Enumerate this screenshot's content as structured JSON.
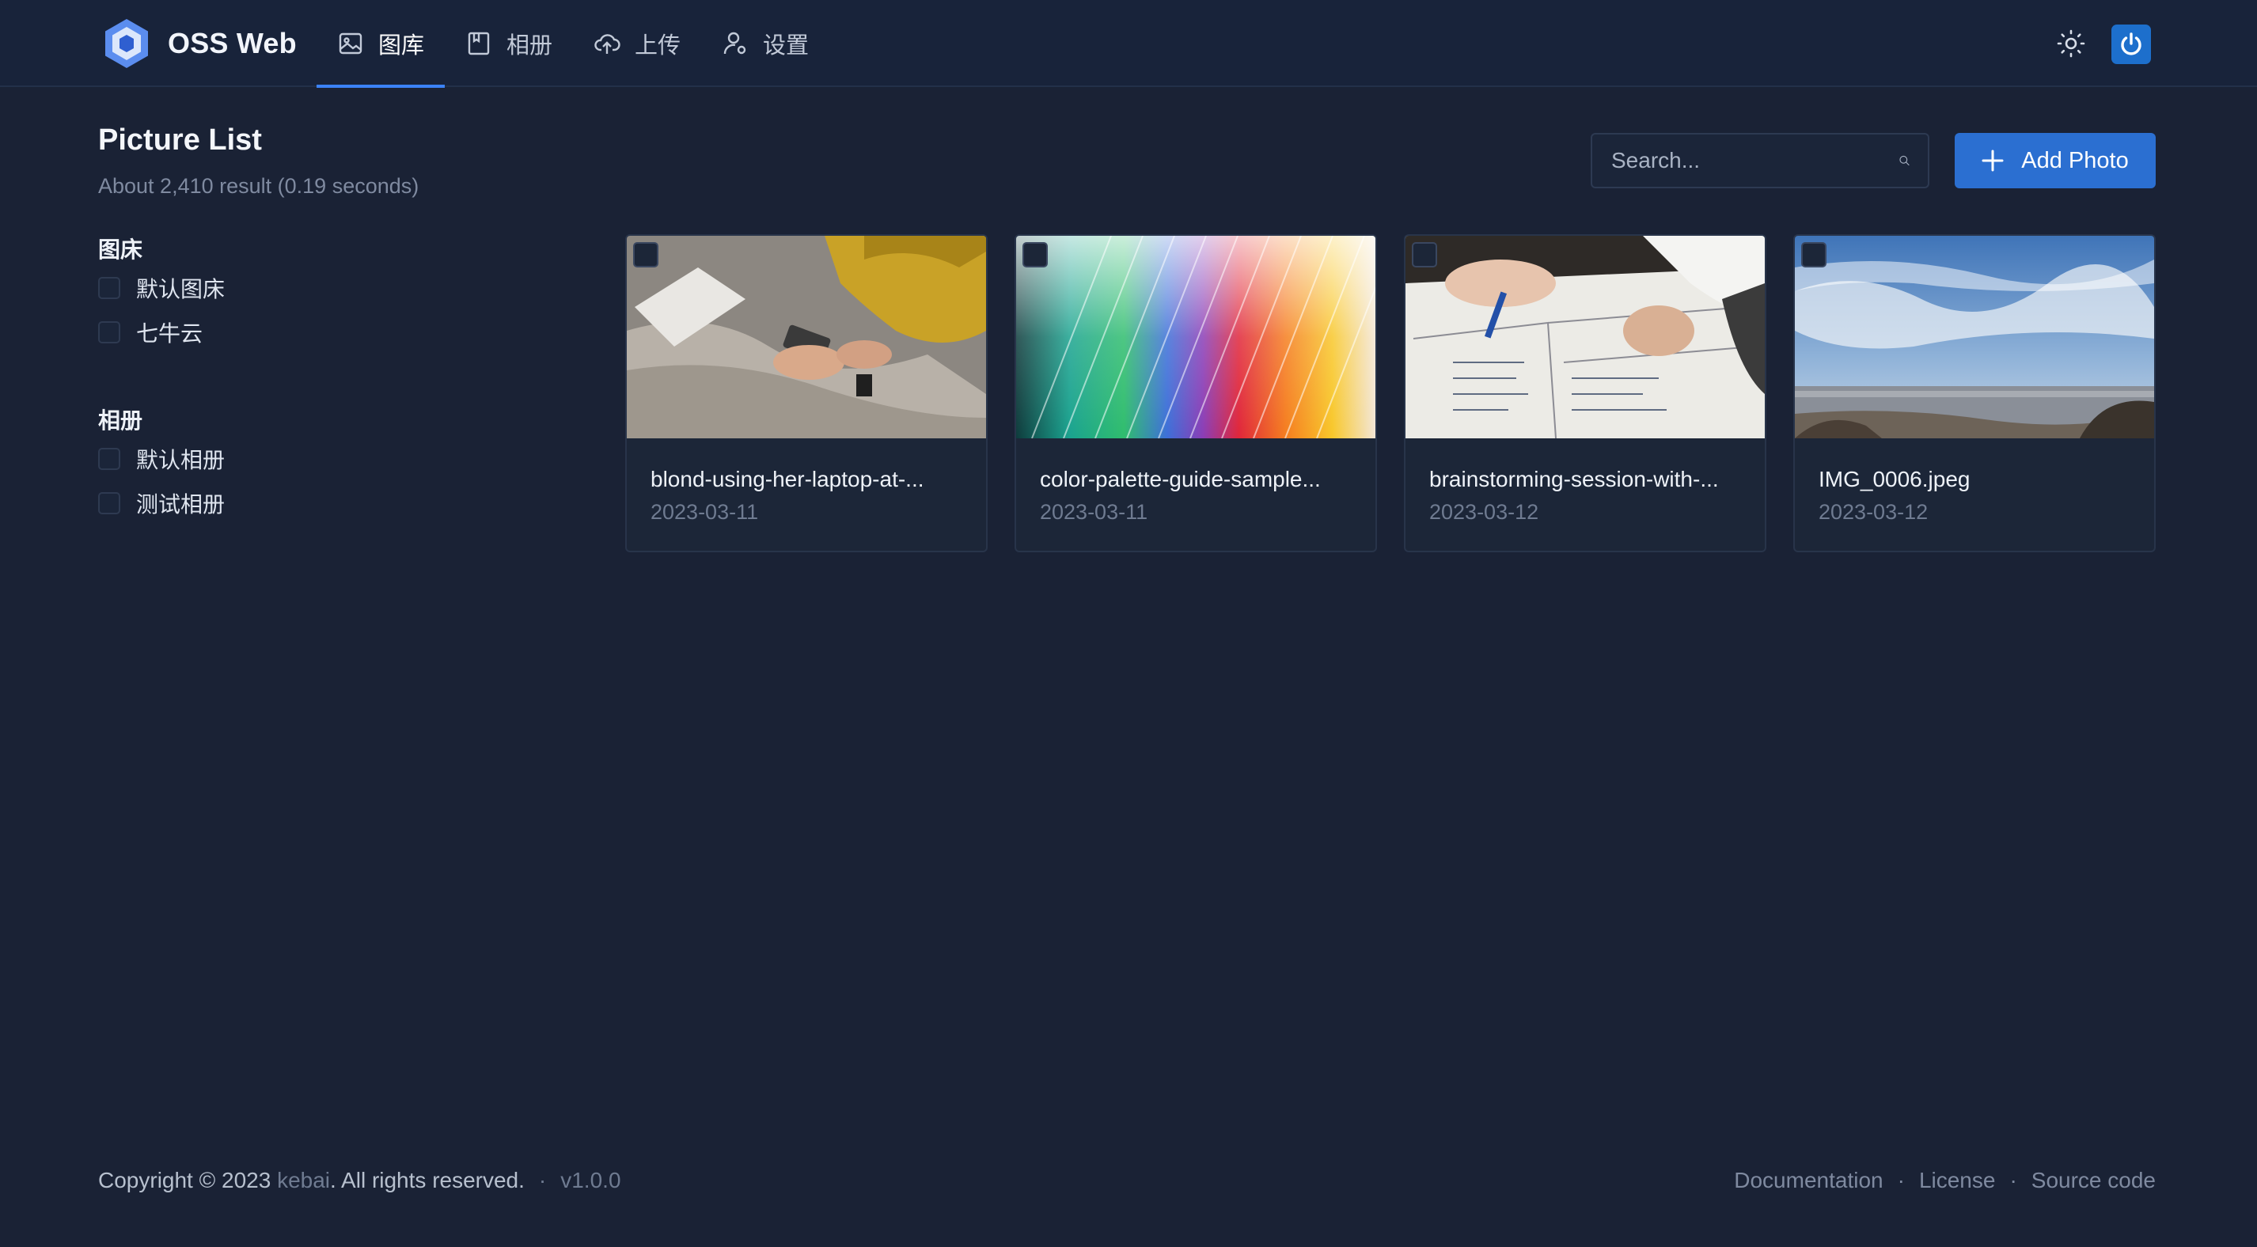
{
  "header": {
    "brand": "OSS Web",
    "nav": [
      {
        "label": "图库",
        "icon": "image-icon",
        "active": true
      },
      {
        "label": "相册",
        "icon": "album-icon",
        "active": false
      },
      {
        "label": "上传",
        "icon": "cloud-upload-icon",
        "active": false
      },
      {
        "label": "设置",
        "icon": "user-settings-icon",
        "active": false
      }
    ],
    "accent_color": "#3b82f6"
  },
  "page": {
    "title": "Picture List",
    "subtitle": "About 2,410 result (0.19 seconds)"
  },
  "search": {
    "placeholder": "Search...",
    "value": ""
  },
  "add_button": {
    "label": "Add Photo"
  },
  "filters": [
    {
      "title": "图床",
      "options": [
        "默认图床",
        "七牛云"
      ]
    },
    {
      "title": "相册",
      "options": [
        "默认相册",
        "测试相册"
      ]
    }
  ],
  "pictures": [
    {
      "name": "blond-using-her-laptop-at-...",
      "date": "2023-03-11"
    },
    {
      "name": "color-palette-guide-sample...",
      "date": "2023-03-11"
    },
    {
      "name": "brainstorming-session-with-...",
      "date": "2023-03-12"
    },
    {
      "name": "IMG_0006.jpeg",
      "date": "2023-03-12"
    }
  ],
  "footer": {
    "copyright_prefix": "Copyright © 2023",
    "author": "kebai",
    "copyright_suffix": ". All rights reserved.",
    "version": "v1.0.0",
    "links": [
      "Documentation",
      "License",
      "Source code"
    ]
  }
}
